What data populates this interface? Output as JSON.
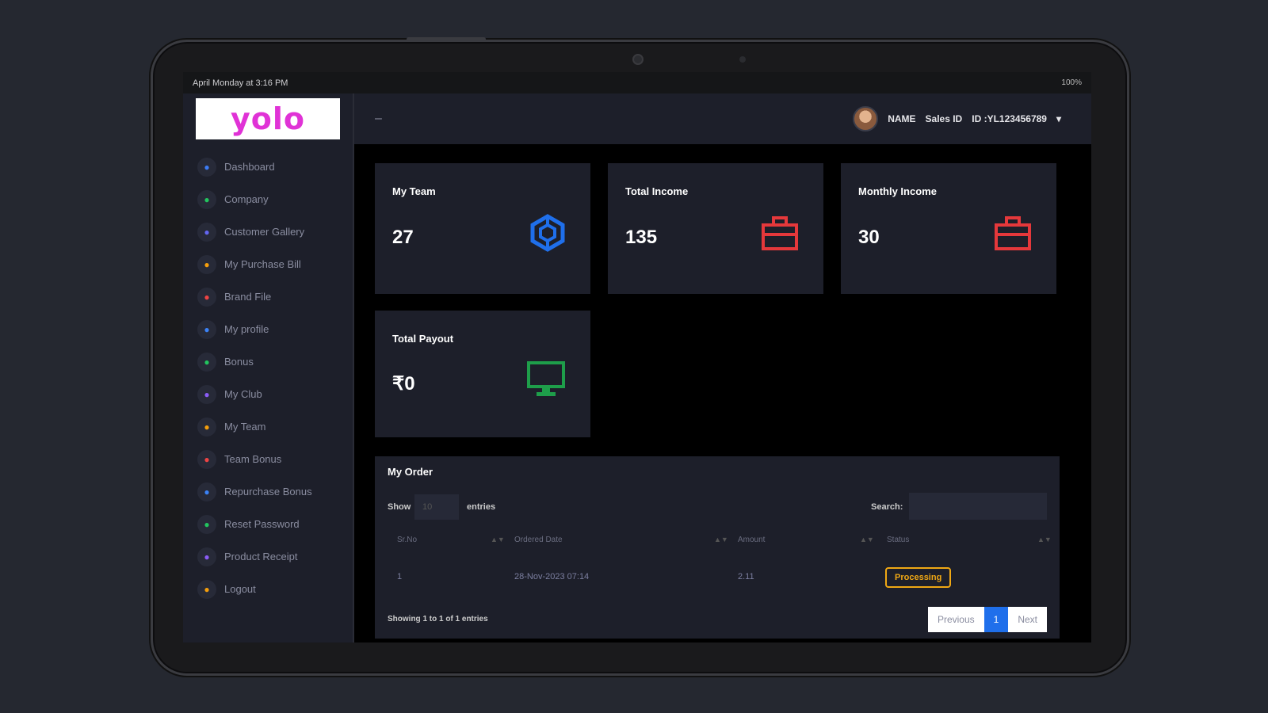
{
  "statusbar": {
    "left": "April Monday at 3:16 PM",
    "right": "100%"
  },
  "logo": "yolo",
  "sidebar": {
    "items": [
      {
        "label": "Dashboard",
        "icon": "x-icon",
        "color": "#3c7cf6"
      },
      {
        "label": "Company",
        "icon": "tree-icon",
        "color": "#22c55e"
      },
      {
        "label": "Customer Gallery",
        "icon": "gallery-icon",
        "color": "#6366f1"
      },
      {
        "label": "My Purchase Bill",
        "icon": "bell-icon",
        "color": "#f59e0b"
      },
      {
        "label": "Brand File",
        "icon": "file-icon",
        "color": "#ef4444"
      },
      {
        "label": "My profile",
        "icon": "user-icon",
        "color": "#3b82f6"
      },
      {
        "label": "Bonus",
        "icon": "dollar-icon",
        "color": "#22c55e"
      },
      {
        "label": "My Club",
        "icon": "club-icon",
        "color": "#8b5cf6"
      },
      {
        "label": "My Team",
        "icon": "team-icon",
        "color": "#f59e0b"
      },
      {
        "label": "Team Bonus",
        "icon": "bonus-icon",
        "color": "#ef4444"
      },
      {
        "label": "Repurchase Bonus",
        "icon": "repurchase-icon",
        "color": "#3b82f6"
      },
      {
        "label": "Reset Password",
        "icon": "lock-icon",
        "color": "#22c55e"
      },
      {
        "label": "Product Receipt",
        "icon": "receipt-icon",
        "color": "#8b5cf6"
      },
      {
        "label": "Logout",
        "icon": "logout-icon",
        "color": "#f59e0b"
      }
    ]
  },
  "topbar": {
    "menu": "–",
    "name": "NAME",
    "role": "Sales ID",
    "id": "ID :YL123456789"
  },
  "cards": [
    {
      "title": "My Team",
      "value": "27",
      "icon": "cube-icon",
      "color": "#1f6feb"
    },
    {
      "title": "Total Income",
      "value": "135",
      "icon": "briefcase-icon",
      "color": "#e5383b"
    },
    {
      "title": "Monthly Income",
      "value": "30",
      "icon": "briefcase-icon",
      "color": "#e5383b"
    },
    {
      "title": "Total Payout",
      "value": "₹0",
      "icon": "monitor-icon",
      "color": "#1e9e4a"
    }
  ],
  "orders": {
    "title": "My Order",
    "show_label": "Show",
    "entries_value": "10",
    "entries_label": "entries",
    "search_label": "Search:",
    "columns": [
      "Sr.No",
      "Ordered Date",
      "Amount",
      "Status"
    ],
    "rows": [
      {
        "sr": "1",
        "date": "28-Nov-2023 07:14",
        "amount": "2.11",
        "status": "Processing"
      }
    ],
    "info": "Showing 1 to 1 of 1 entries",
    "pager": {
      "prev": "Previous",
      "page": "1",
      "next": "Next"
    }
  }
}
